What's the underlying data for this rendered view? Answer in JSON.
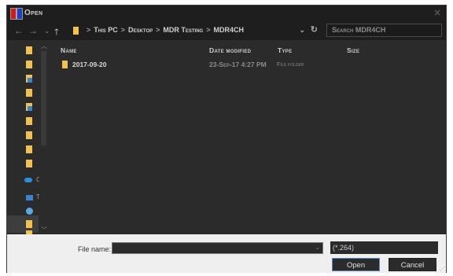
{
  "window": {
    "title": "Open",
    "icon": "app-flag-icon",
    "close": "✕"
  },
  "nav": {
    "back": "←",
    "forward": "→",
    "recent": "⌄",
    "up": "🡑"
  },
  "address": {
    "segments": [
      "This PC",
      "Desktop",
      "MDR Testing",
      "MDR4CH"
    ],
    "separator": ">",
    "dropdown": "⌄",
    "refresh": "↻"
  },
  "search": {
    "placeholder": "Search MDR4CH"
  },
  "columns": {
    "name": "Name",
    "date": "Date modified",
    "type": "Type",
    "size": "Size"
  },
  "files": [
    {
      "name": "2017-09-20",
      "date": "23-Sep-17 4:27 PM",
      "type": "File folder",
      "size": ""
    }
  ],
  "sidebar": {
    "labels": [
      "C",
      "T"
    ]
  },
  "footer": {
    "file_name_label": "File name:",
    "file_name_value": "",
    "filter": "(*.264)",
    "open_label": "Open",
    "cancel_label": "Cancel"
  },
  "colors": {
    "folder": "#f2c24a",
    "accent": "#5b86c5",
    "dark_bg": "#2b2b2b"
  }
}
